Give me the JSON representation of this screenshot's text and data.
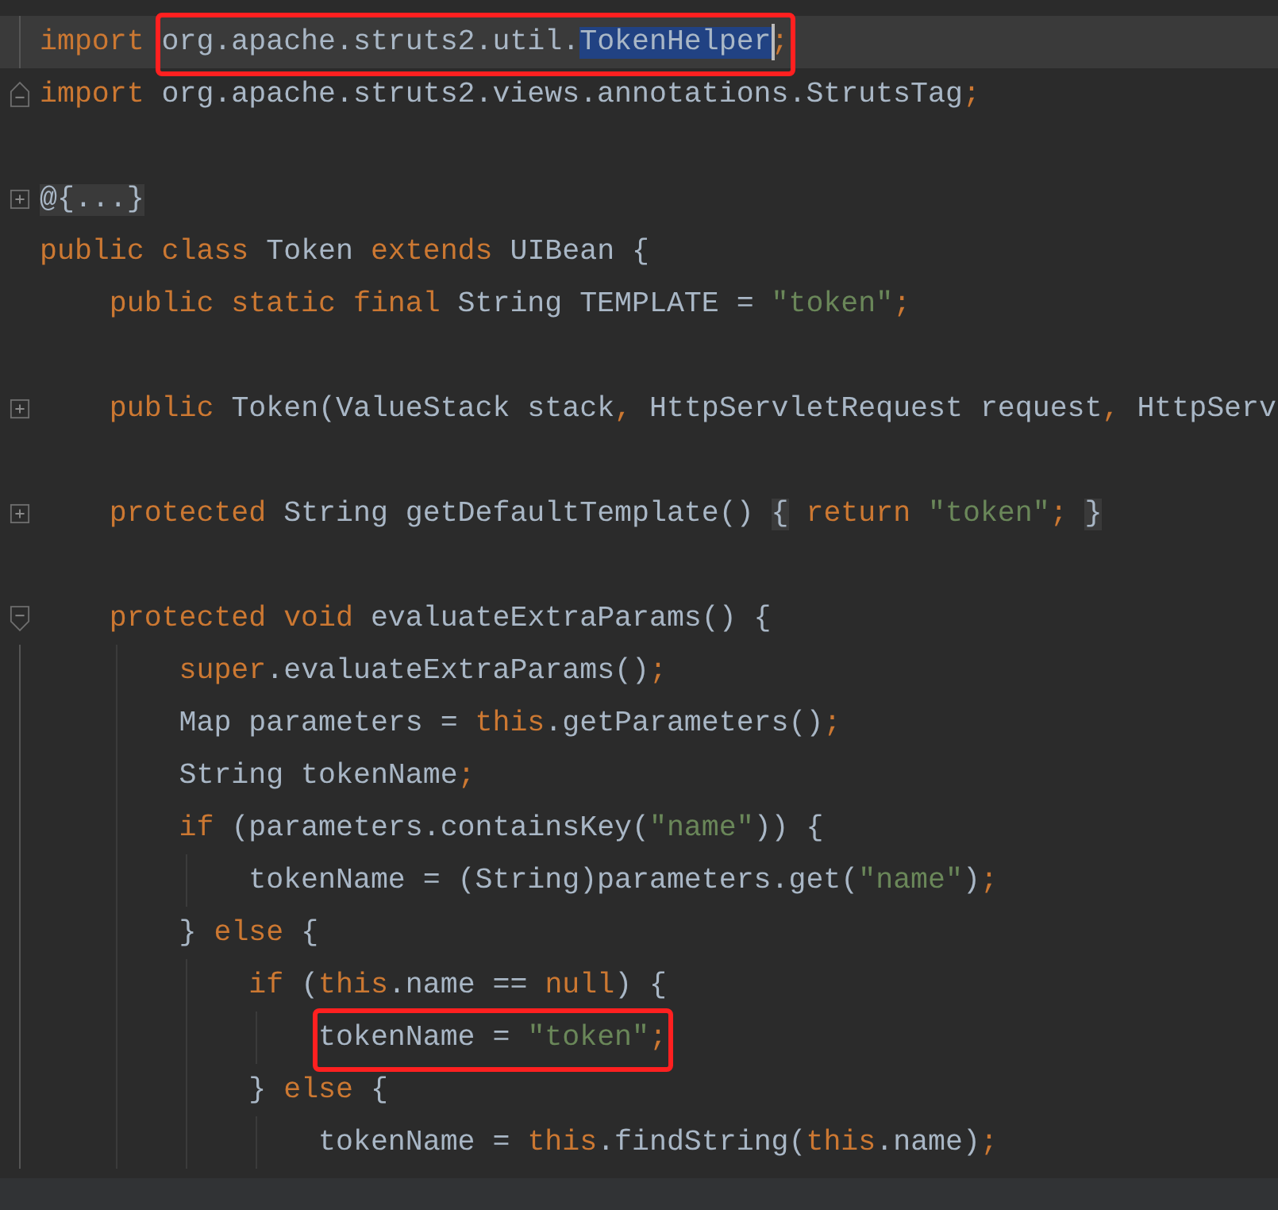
{
  "editor": {
    "lines": [
      {
        "kind": "plain",
        "current": true,
        "tokens": [
          {
            "t": "import ",
            "kind": "keyword"
          },
          {
            "t": "org.apache.struts2.util.",
            "kind": "identifier",
            "boxed": true
          },
          {
            "t": "TokenHelper",
            "kind": "selection",
            "boxed": true,
            "caret": true
          },
          {
            "t": ";",
            "kind": "keyword",
            "boxed": true
          }
        ]
      },
      {
        "kind": "foldend",
        "tokens": [
          {
            "t": "import",
            "kind": "keyword"
          },
          {
            "t": " org.apache.struts2.views.annotations.StrutsTag",
            "kind": "identifier"
          },
          {
            "t": ";",
            "kind": "keyword"
          }
        ]
      },
      {
        "kind": "blank"
      },
      {
        "kind": "folded",
        "tokens": [
          {
            "t": "@{...}",
            "kind": "placeholder"
          }
        ]
      },
      {
        "kind": "plain",
        "tokens": [
          {
            "t": "public class ",
            "kind": "keyword"
          },
          {
            "t": "Token ",
            "kind": "identifier"
          },
          {
            "t": "extends ",
            "kind": "keyword"
          },
          {
            "t": "UIBean {",
            "kind": "identifier"
          }
        ]
      },
      {
        "kind": "plain",
        "tokens": [
          {
            "t": "    public static final ",
            "kind": "keyword"
          },
          {
            "t": "String TEMPLATE = ",
            "kind": "identifier"
          },
          {
            "t": "\"token\"",
            "kind": "string"
          },
          {
            "t": ";",
            "kind": "keyword"
          }
        ]
      },
      {
        "kind": "blank"
      },
      {
        "kind": "folded",
        "tokens": [
          {
            "t": "    public ",
            "kind": "keyword"
          },
          {
            "t": "Token(ValueStack stack",
            "kind": "identifier"
          },
          {
            "t": ", ",
            "kind": "keyword"
          },
          {
            "t": "HttpServletRequest request",
            "kind": "identifier"
          },
          {
            "t": ", ",
            "kind": "keyword"
          },
          {
            "t": "HttpServ",
            "kind": "identifier"
          }
        ]
      },
      {
        "kind": "blank"
      },
      {
        "kind": "folded",
        "tokens": [
          {
            "t": "    protected ",
            "kind": "keyword"
          },
          {
            "t": "String getDefaultTemplate() ",
            "kind": "identifier"
          },
          {
            "t": "{",
            "kind": "placeholder"
          },
          {
            "t": " return ",
            "kind": "keyword"
          },
          {
            "t": "\"token\"",
            "kind": "string"
          },
          {
            "t": "; ",
            "kind": "keyword"
          },
          {
            "t": "}",
            "kind": "placeholder"
          }
        ]
      },
      {
        "kind": "blank"
      },
      {
        "kind": "foldstart",
        "tokens": [
          {
            "t": "    protected void ",
            "kind": "keyword"
          },
          {
            "t": "evaluateExtraParams() {",
            "kind": "identifier"
          }
        ]
      },
      {
        "kind": "plain",
        "tokens": [
          {
            "t": "        super",
            "kind": "keyword"
          },
          {
            "t": ".evaluateExtraParams()",
            "kind": "identifier"
          },
          {
            "t": ";",
            "kind": "keyword"
          }
        ]
      },
      {
        "kind": "plain",
        "tokens": [
          {
            "t": "        Map parameters = ",
            "kind": "identifier"
          },
          {
            "t": "this",
            "kind": "keyword"
          },
          {
            "t": ".getParameters()",
            "kind": "identifier"
          },
          {
            "t": ";",
            "kind": "keyword"
          }
        ]
      },
      {
        "kind": "plain",
        "tokens": [
          {
            "t": "        String tokenName",
            "kind": "identifier"
          },
          {
            "t": ";",
            "kind": "keyword"
          }
        ]
      },
      {
        "kind": "plain",
        "tokens": [
          {
            "t": "        if ",
            "kind": "keyword"
          },
          {
            "t": "(parameters.containsKey(",
            "kind": "identifier"
          },
          {
            "t": "\"name\"",
            "kind": "string"
          },
          {
            "t": ")) {",
            "kind": "identifier"
          }
        ]
      },
      {
        "kind": "plain",
        "tokens": [
          {
            "t": "            tokenName = (String)parameters.get(",
            "kind": "identifier"
          },
          {
            "t": "\"name\"",
            "kind": "string"
          },
          {
            "t": ")",
            "kind": "identifier"
          },
          {
            "t": ";",
            "kind": "keyword"
          }
        ]
      },
      {
        "kind": "plain",
        "tokens": [
          {
            "t": "        } ",
            "kind": "identifier"
          },
          {
            "t": "else ",
            "kind": "keyword"
          },
          {
            "t": "{",
            "kind": "identifier"
          }
        ]
      },
      {
        "kind": "plain",
        "tokens": [
          {
            "t": "            if ",
            "kind": "keyword"
          },
          {
            "t": "(",
            "kind": "identifier"
          },
          {
            "t": "this",
            "kind": "keyword"
          },
          {
            "t": ".name == ",
            "kind": "identifier"
          },
          {
            "t": "null",
            "kind": "keyword"
          },
          {
            "t": ") {",
            "kind": "identifier"
          }
        ]
      },
      {
        "kind": "plain",
        "tokens": [
          {
            "t": "                tokenName = ",
            "kind": "identifier",
            "boxed": true
          },
          {
            "t": "\"token\"",
            "kind": "string",
            "boxed": true
          },
          {
            "t": ";",
            "kind": "keyword",
            "boxed": true
          }
        ]
      },
      {
        "kind": "plain",
        "tokens": [
          {
            "t": "            } ",
            "kind": "identifier"
          },
          {
            "t": "else ",
            "kind": "keyword"
          },
          {
            "t": "{",
            "kind": "identifier"
          }
        ]
      },
      {
        "kind": "plain",
        "tokens": [
          {
            "t": "                tokenName = ",
            "kind": "identifier"
          },
          {
            "t": "this",
            "kind": "keyword"
          },
          {
            "t": ".findString(",
            "kind": "identifier"
          },
          {
            "t": "this",
            "kind": "keyword"
          },
          {
            "t": ".name)",
            "kind": "identifier"
          },
          {
            "t": ";",
            "kind": "keyword"
          }
        ]
      }
    ]
  }
}
